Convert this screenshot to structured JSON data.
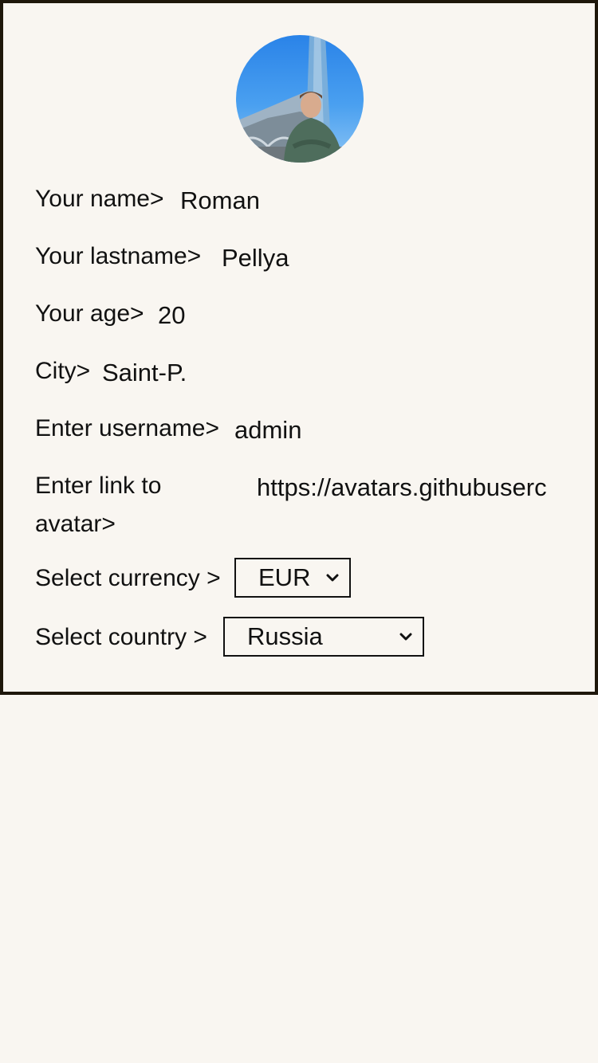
{
  "profile": {
    "fields": [
      {
        "label": "Your name>",
        "value": "Roman"
      },
      {
        "label": "Your lastname>",
        "value": "Pellya"
      },
      {
        "label": "Your age>",
        "value": "20"
      },
      {
        "label": "City>",
        "value": "Saint-P."
      },
      {
        "label": "Enter username>",
        "value": "admin"
      }
    ],
    "avatar_link": {
      "label": "Enter link to avatar>",
      "value": "https://avatars.githubuserc"
    },
    "currency": {
      "label": "Select currency >",
      "selected": "EUR"
    },
    "country": {
      "label": "Select country >",
      "selected": "Russia"
    }
  },
  "colors": {
    "background": "#f9f6f1",
    "border": "#1e170b",
    "text": "#111111"
  },
  "icons": {
    "dropdown": "chevron-down-icon"
  }
}
